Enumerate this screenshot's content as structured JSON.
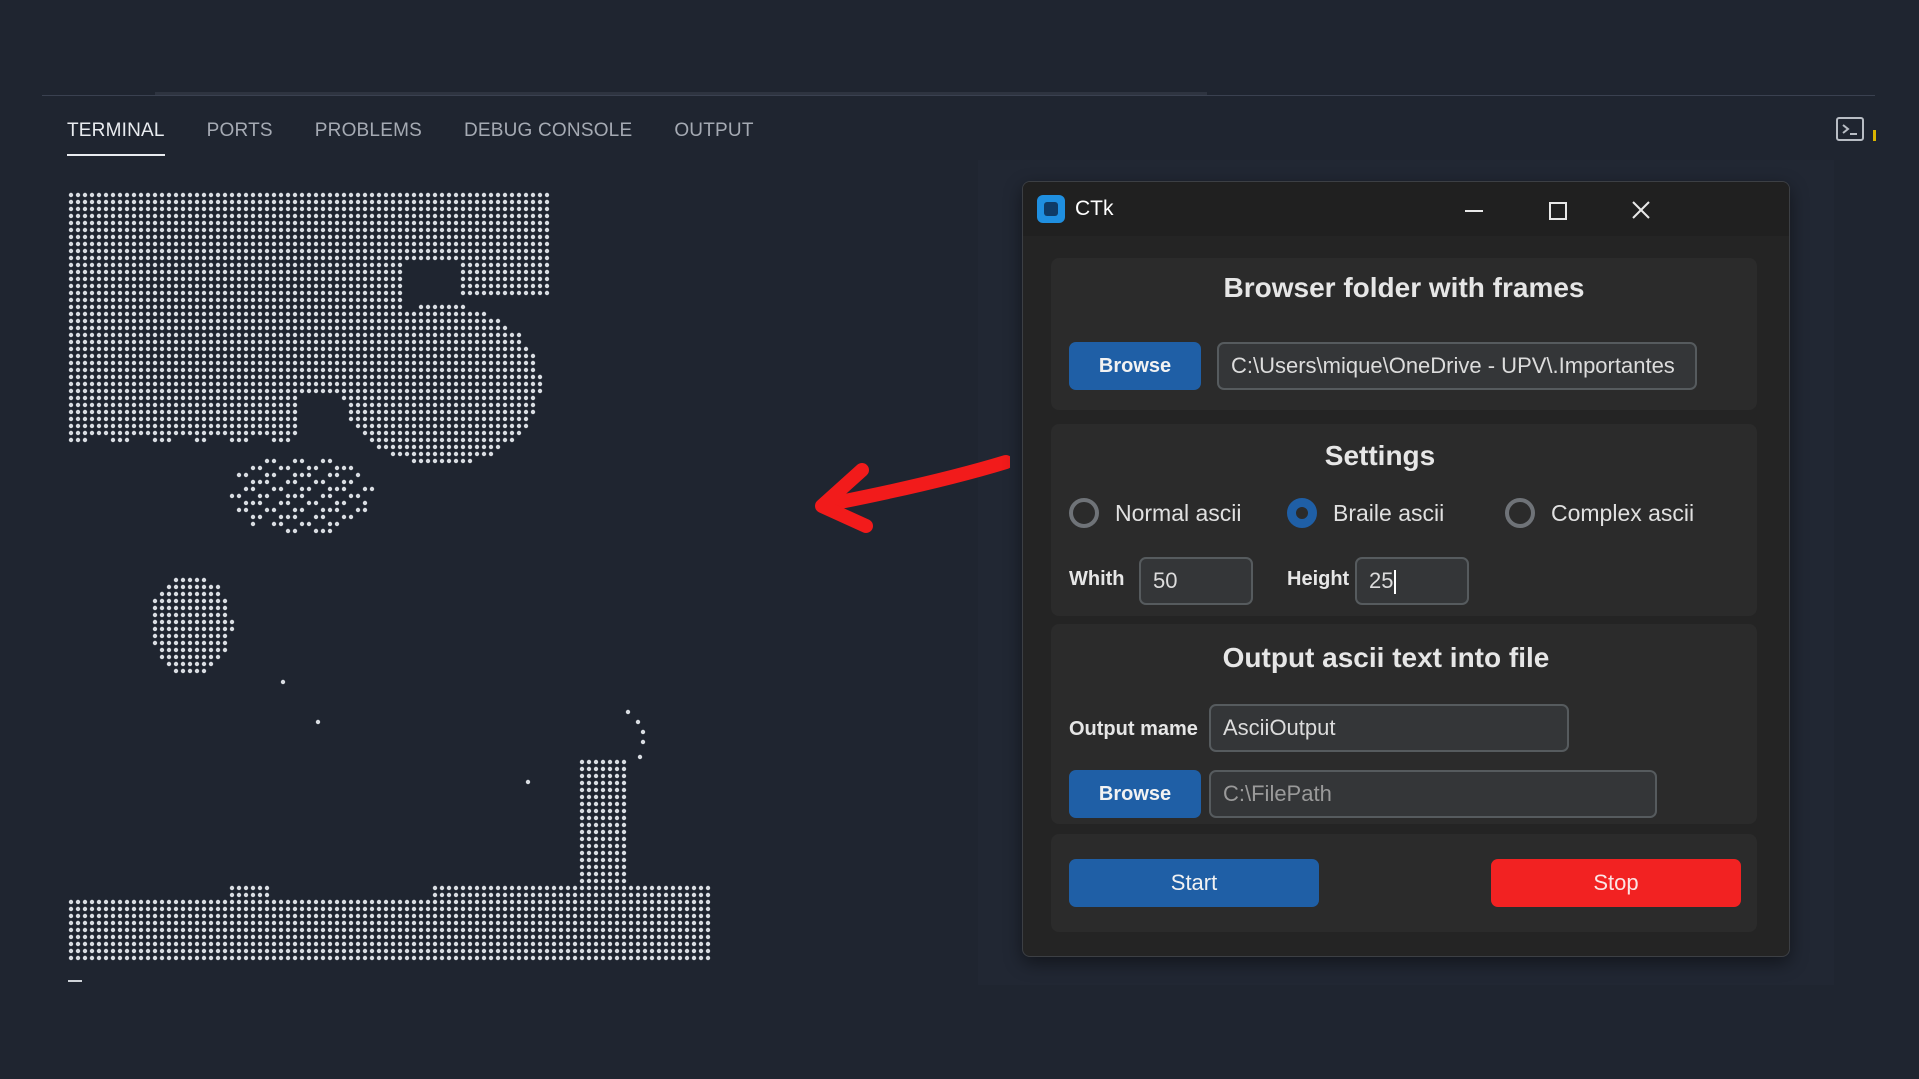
{
  "panel": {
    "tabs": [
      {
        "label": "TERMINAL",
        "active": true
      },
      {
        "label": "PORTS",
        "active": false
      },
      {
        "label": "PROBLEMS",
        "active": false
      },
      {
        "label": "DEBUG CONSOLE",
        "active": false
      },
      {
        "label": "OUTPUT",
        "active": false
      }
    ],
    "terminal_icon": "terminal-icon"
  },
  "annotation": {
    "arrow_icon": "red-arrow-icon",
    "arrow_color": "#f21b1b"
  },
  "window": {
    "title": "CTk",
    "controls": {
      "minimize": "minimize-icon",
      "maximize": "maximize-icon",
      "close": "close-icon"
    },
    "browse_section": {
      "title": "Browser folder with frames",
      "browse_label": "Browse",
      "path_value": "C:\\Users\\mique\\OneDrive - UPV\\.Importantes"
    },
    "settings": {
      "title": "Settings",
      "radios": [
        {
          "label": "Normal ascii",
          "checked": false
        },
        {
          "label": "Braile ascii",
          "checked": true
        },
        {
          "label": "Complex ascii",
          "checked": false
        }
      ],
      "width_label": "Whith",
      "width_value": "50",
      "height_label": "Height",
      "height_value": "25"
    },
    "output": {
      "title": "Output ascii text into file",
      "name_label": "Output mame",
      "name_value": "AsciiOutput",
      "browse_label": "Browse",
      "path_placeholder": "C:\\FilePath"
    },
    "actions": {
      "start_label": "Start",
      "stop_label": "Stop"
    }
  },
  "colors": {
    "background": "#1f2530",
    "accent_blue": "#1f5fa6",
    "stop_red": "#f22222",
    "ascii_dots": "#d9dde2"
  }
}
